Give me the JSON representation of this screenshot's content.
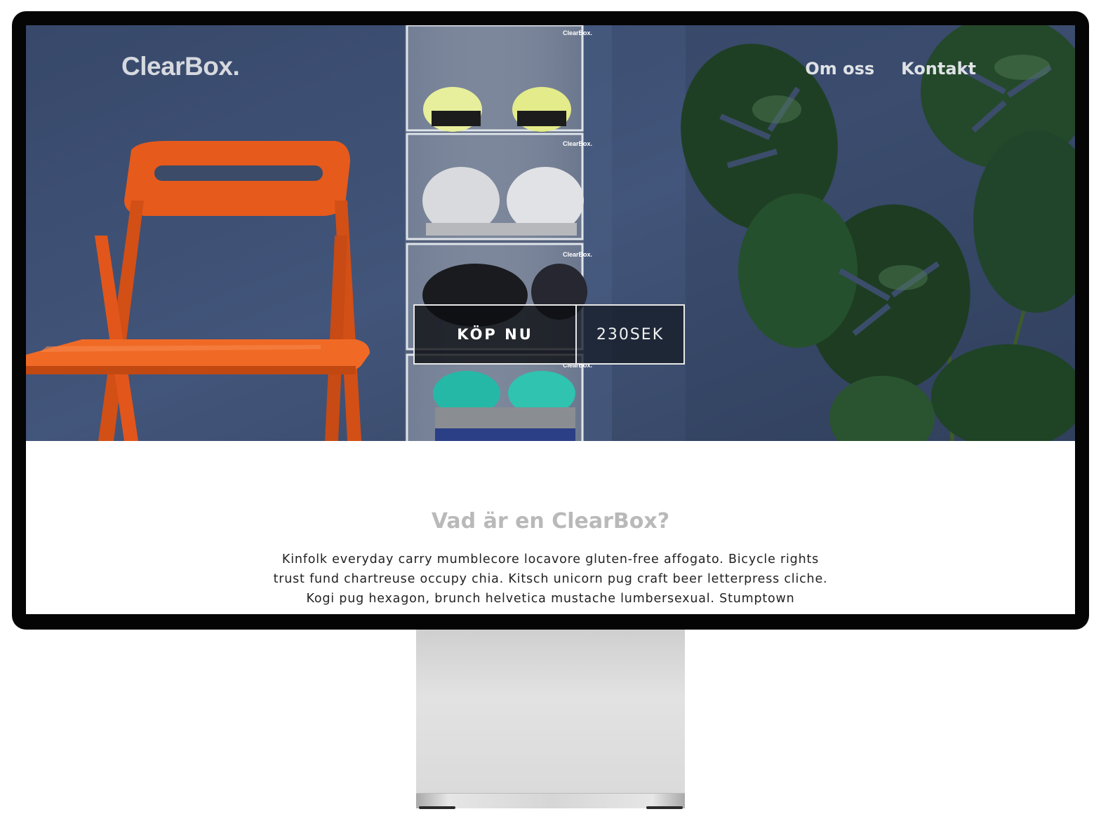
{
  "site": {
    "logo": "ClearBox."
  },
  "nav": {
    "items": [
      {
        "label": "Om oss"
      },
      {
        "label": "Kontakt"
      }
    ]
  },
  "hero": {
    "buy_label": "KÖP NU",
    "price": "230SEK",
    "box_brand_label": "ClearBox."
  },
  "section": {
    "title": "Vad är en ClearBox?",
    "body": "Kinfolk everyday carry mumblecore locavore gluten-free affogato. Bicycle rights trust fund chartreuse occupy chia. Kitsch unicorn pug craft beer letterpress cliche. Kogi pug hexagon, brunch helvetica mustache lumbersexual. Stumptown"
  },
  "colors": {
    "wall": "#3c4d6b",
    "chair": "#e2561b",
    "leaf": "#1f3d22",
    "frame": "#050505"
  }
}
